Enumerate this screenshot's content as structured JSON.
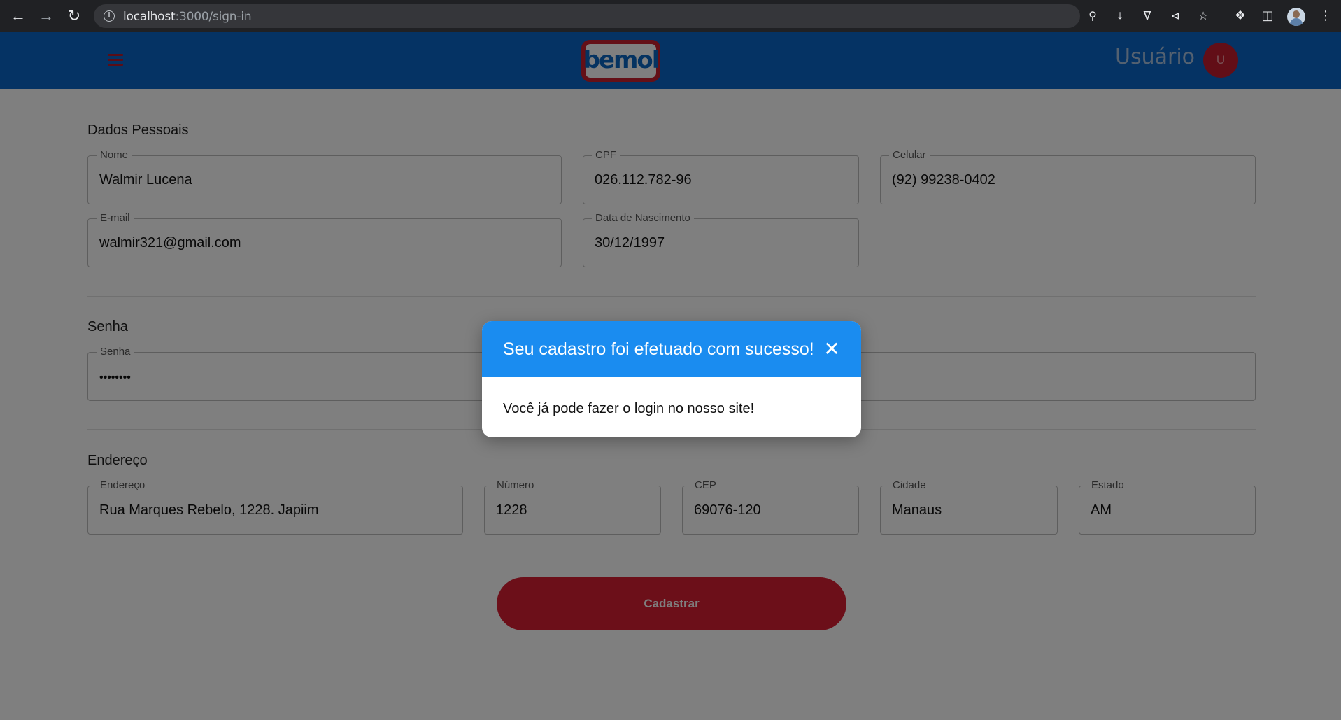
{
  "browser": {
    "url_host": "localhost",
    "url_path": ":3000/sign-in",
    "icons": [
      "back-icon",
      "forward-icon",
      "reload-icon",
      "info-icon",
      "key-icon",
      "install-icon",
      "translate-icon",
      "share-icon",
      "star-icon",
      "extensions-icon",
      "side-panel-icon",
      "profile-avatar",
      "menu-dots-icon"
    ]
  },
  "header": {
    "logo_text": "bemol",
    "user_label": "Usuário",
    "avatar_letter": "U",
    "colors": {
      "bar": "#0a66c8",
      "accent": "#c8202f"
    }
  },
  "personal": {
    "title": "Dados Pessoais",
    "nome": {
      "label": "Nome",
      "value": "Walmir Lucena"
    },
    "cpf": {
      "label": "CPF",
      "value": "026.112.782-96"
    },
    "celular": {
      "label": "Celular",
      "value": "(92) 99238-0402"
    },
    "email": {
      "label": "E-mail",
      "value": "walmir321@gmail.com"
    },
    "nascimento": {
      "label": "Data de Nascimento",
      "value": "30/12/1997"
    }
  },
  "password": {
    "title": "Senha",
    "senha": {
      "label": "Senha",
      "value": "••••••••"
    }
  },
  "address": {
    "title": "Endereço",
    "endereco": {
      "label": "Endereço",
      "value": "Rua Marques Rebelo, 1228. Japiim"
    },
    "numero": {
      "label": "Número",
      "value": "1228"
    },
    "cep": {
      "label": "CEP",
      "value": "69076-120"
    },
    "cidade": {
      "label": "Cidade",
      "value": "Manaus"
    },
    "estado": {
      "label": "Estado",
      "value": "AM"
    }
  },
  "submit_label": "Cadastrar",
  "modal": {
    "title": "Seu cadastro foi efetuado com sucesso!",
    "body": "Você já pode fazer o login no nosso site!",
    "header_color": "#1a8cf0"
  }
}
